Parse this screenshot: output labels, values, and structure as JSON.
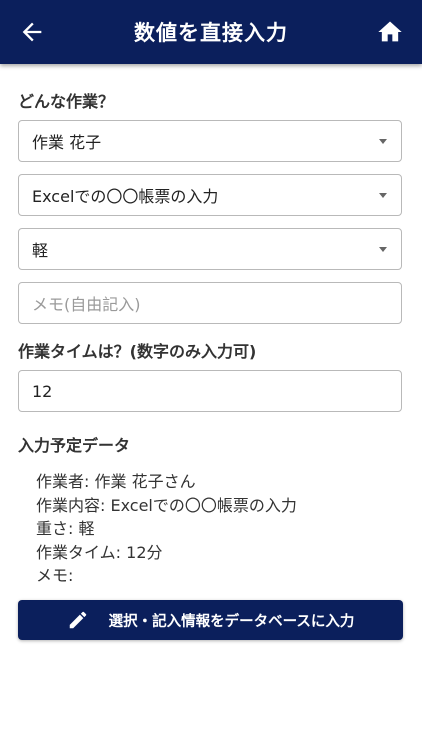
{
  "header": {
    "title": "数値を直接入力"
  },
  "form": {
    "question_label": "どんな作業？",
    "worker_select": "作業 花子",
    "task_select": "Excelでの〇〇帳票の入力",
    "weight_select": "軽",
    "memo_placeholder": "メモ(自由記入)",
    "time_label": "作業タイムは？(数字のみ入力可)",
    "time_value": "12"
  },
  "summary": {
    "heading": "入力予定データ",
    "worker": "作業者: 作業 花子さん",
    "task": "作業内容: Excelでの〇〇帳票の入力",
    "weight": "重さ: 軽",
    "time": "作業タイム: 12分",
    "memo": "メモ:"
  },
  "submit": {
    "label": "選択・記入情報をデータベースに入力"
  },
  "colors": {
    "primary": "#0b1f5c",
    "border": "#b9b9b9"
  },
  "icons": {
    "back": "arrow-left-icon",
    "home": "home-icon",
    "edit": "pencil-icon",
    "dropdown": "caret-down-icon"
  }
}
